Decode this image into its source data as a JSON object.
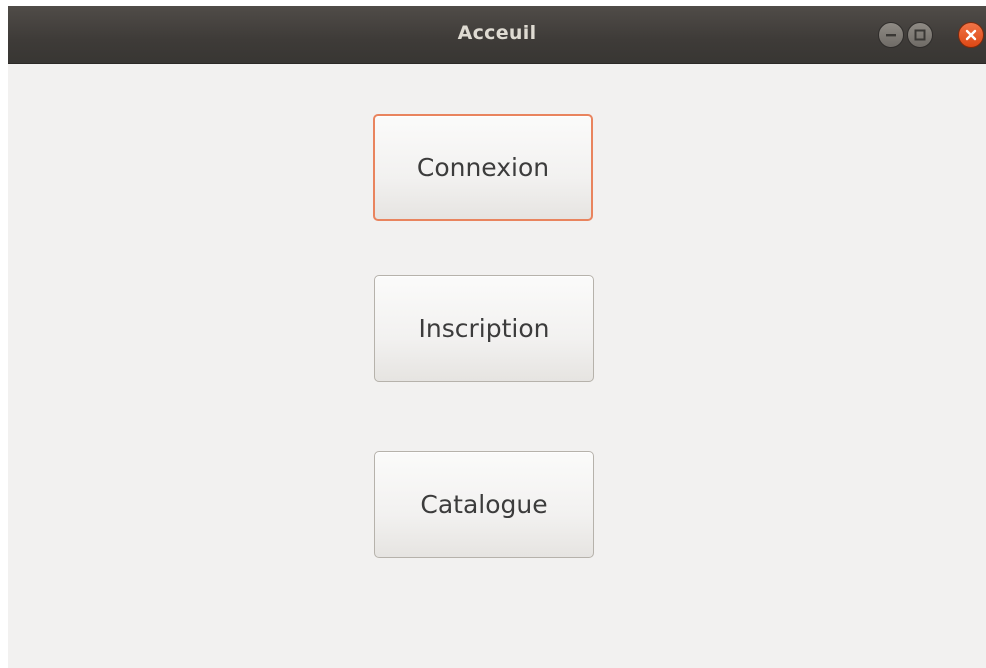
{
  "window": {
    "title": "Acceuil",
    "controls": {
      "minimize_icon": "minimize-icon",
      "maximize_icon": "maximize-icon",
      "close_icon": "close-icon"
    }
  },
  "buttons": {
    "connexion": "Connexion",
    "inscription": "Inscription",
    "catalogue": "Catalogue"
  },
  "colors": {
    "titlebar": "#3e3b38",
    "window_bg": "#f2f1f0",
    "focus_ring": "#e9845e",
    "close_button": "#dd4814"
  }
}
